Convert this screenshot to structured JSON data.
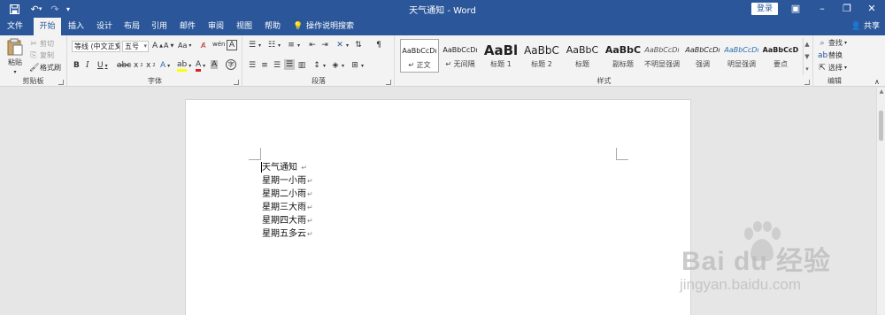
{
  "app": {
    "doc_title": "天气通知 - Word",
    "login": "登录",
    "share": "共享",
    "tell_me": "操作说明搜索"
  },
  "tabs": [
    "文件",
    "开始",
    "插入",
    "设计",
    "布局",
    "引用",
    "邮件",
    "审阅",
    "视图",
    "帮助"
  ],
  "clipboard": {
    "paste": "粘贴",
    "cut": "剪切",
    "copy": "复制",
    "format_painter": "格式刷",
    "label": "剪贴板"
  },
  "font": {
    "name": "等线 (中文正文)",
    "size": "五号",
    "label": "字体"
  },
  "paragraph": {
    "label": "段落"
  },
  "styles": {
    "label": "样式",
    "items": [
      {
        "preview": "AaBbCcDı",
        "name": "↵ 正文"
      },
      {
        "preview": "AaBbCcDı",
        "name": "↵ 无间隔"
      },
      {
        "preview": "AaBl",
        "name": "标题 1"
      },
      {
        "preview": "AaBbC",
        "name": "标题 2"
      },
      {
        "preview": "AaBbC",
        "name": "标题"
      },
      {
        "preview": "AaBbC",
        "name": "副标题"
      },
      {
        "preview": "AaBbCcDı",
        "name": "不明显强调"
      },
      {
        "preview": "AaBbCcDı",
        "name": "强调"
      },
      {
        "preview": "AaBbCcDı",
        "name": "明显强调"
      },
      {
        "preview": "AaBbCcD",
        "name": "要点"
      }
    ]
  },
  "editing": {
    "find": "查找",
    "replace": "替换",
    "select": "选择",
    "label": "编辑"
  },
  "document": {
    "lines": [
      "天气通知",
      "星期一小雨",
      "星期二小雨",
      "星期三大雨",
      "星期四大雨",
      "星期五多云"
    ],
    "para_mark": "↵"
  },
  "watermark": {
    "brand": "Bai du 经验",
    "url": "jingyan.baidu.com"
  },
  "colors": {
    "brand_blue": "#2b579a",
    "font_color_red": "#e02020",
    "highlight_yellow": "#ffff00"
  }
}
